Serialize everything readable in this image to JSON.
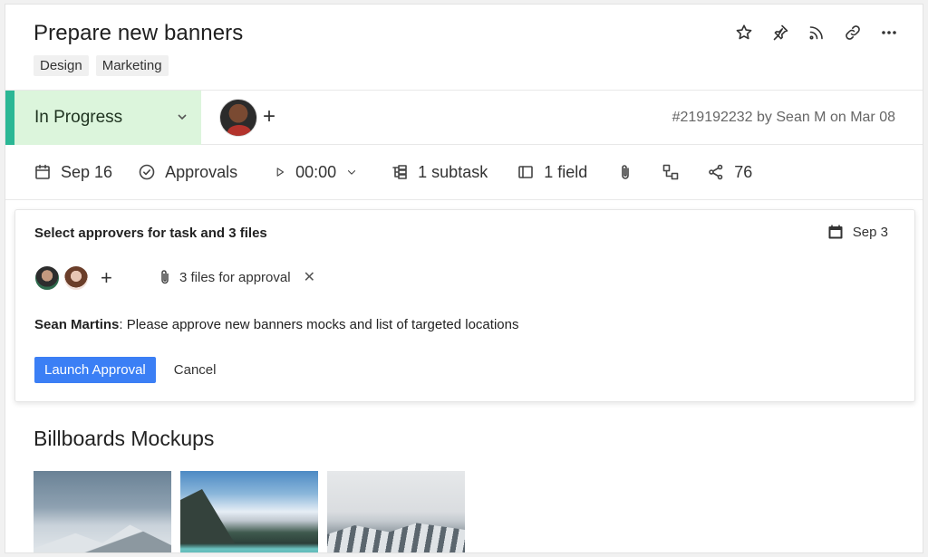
{
  "task": {
    "title": "Prepare new banners",
    "tags": [
      "Design",
      "Marketing"
    ],
    "status": "In Progress",
    "meta": "#219192232 by Sean M on Mar 08"
  },
  "header_actions": [
    "star-icon",
    "pin-icon",
    "rss-icon",
    "link-icon",
    "more-icon"
  ],
  "toolbar": {
    "date": "Sep 16",
    "approvals": "Approvals",
    "timer": "00:00",
    "subtasks": "1 subtask",
    "fields": "1 field",
    "shares": "76"
  },
  "approval": {
    "title": "Select approvers for task and 3 files",
    "due": "Sep 3",
    "files": "3 files for approval",
    "author": "Sean Martins",
    "message": ": Please approve new banners mocks and list of targeted locations",
    "launch_label": "Launch Approval",
    "cancel_label": "Cancel"
  },
  "section": {
    "title": "Billboards Mockups"
  },
  "colors": {
    "status_bg": "#dcf5dc",
    "status_accent": "#2bb795",
    "primary": "#3b7ff5"
  }
}
